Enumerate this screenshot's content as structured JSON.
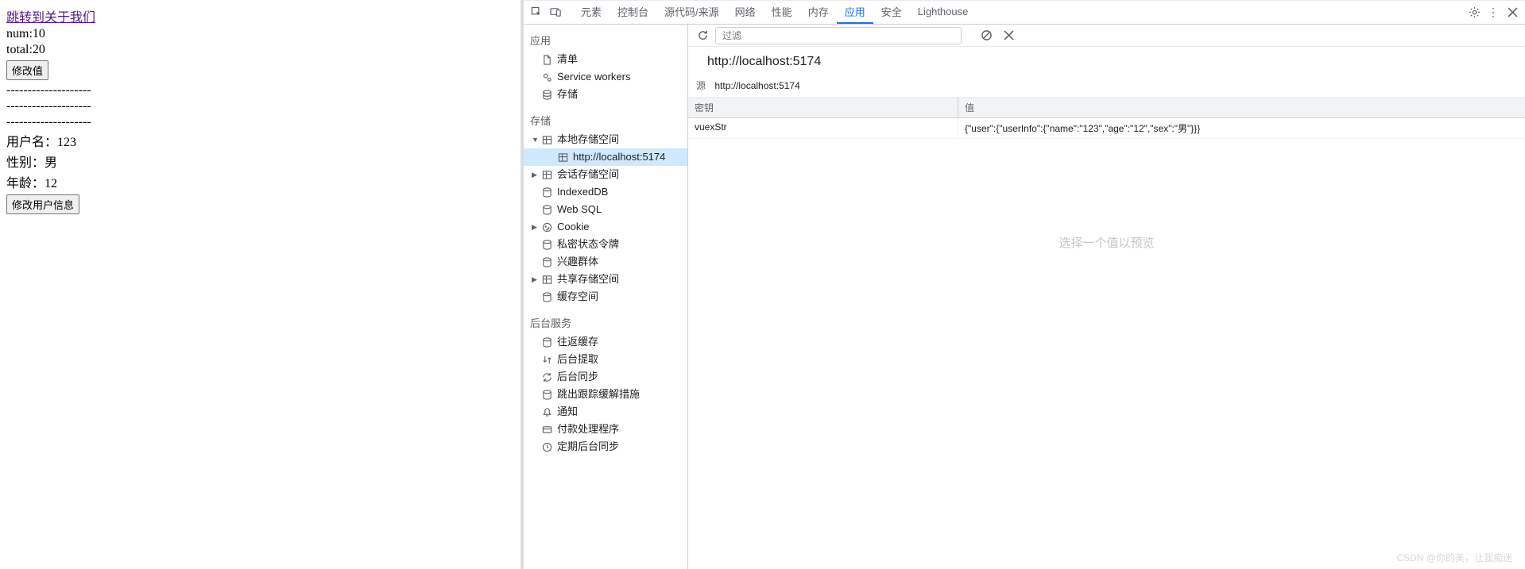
{
  "page": {
    "link": "跳转到关于我们",
    "num_label": "num:",
    "num_value": "10",
    "total_label": "total:",
    "total_value": "20",
    "btn1": "修改值",
    "dashes": "--------------------",
    "username_label": "用户名：",
    "username_value": "123",
    "sex_label": "性别：",
    "sex_value": "男",
    "age_label": "年龄：",
    "age_value": "12",
    "btn2": "修改用户信息"
  },
  "tabs": {
    "elements": "元素",
    "console": "控制台",
    "sources": "源代码/来源",
    "network": "网络",
    "performance": "性能",
    "memory": "内存",
    "application": "应用",
    "security": "安全",
    "lighthouse": "Lighthouse"
  },
  "sidebar": {
    "app_group": "应用",
    "app": {
      "manifest": "清单",
      "service_workers": "Service workers",
      "storage": "存储"
    },
    "storage_group": "存储",
    "storage": {
      "local": "本地存储空间",
      "local_child": "http://localhost:5174",
      "session": "会话存储空间",
      "indexeddb": "IndexedDB",
      "websql": "Web SQL",
      "cookie": "Cookie",
      "private": "私密状态令牌",
      "interest": "兴趣群体",
      "shared": "共享存储空间",
      "cache": "缓存空间"
    },
    "bg_group": "后台服务",
    "bg": {
      "bfcache": "往返缓存",
      "bgfetch": "后台提取",
      "bgsync": "后台同步",
      "bounce": "跳出跟踪缓解措施",
      "notify": "通知",
      "payment": "付款处理程序",
      "periodic": "定期后台同步"
    }
  },
  "detail": {
    "filter_placeholder": "过滤",
    "origin_title": "http://localhost:5174",
    "src_label": "源",
    "src_value": "http://localhost:5174",
    "col_key": "密钥",
    "col_val": "值",
    "row_key": "vuexStr",
    "row_val": "{\"user\":{\"userInfo\":{\"name\":\"123\",\"age\":\"12\",\"sex\":\"男\"}}}",
    "preview": "选择一个值以预览"
  },
  "watermark": "CSDN @你的美，让我痴迷"
}
